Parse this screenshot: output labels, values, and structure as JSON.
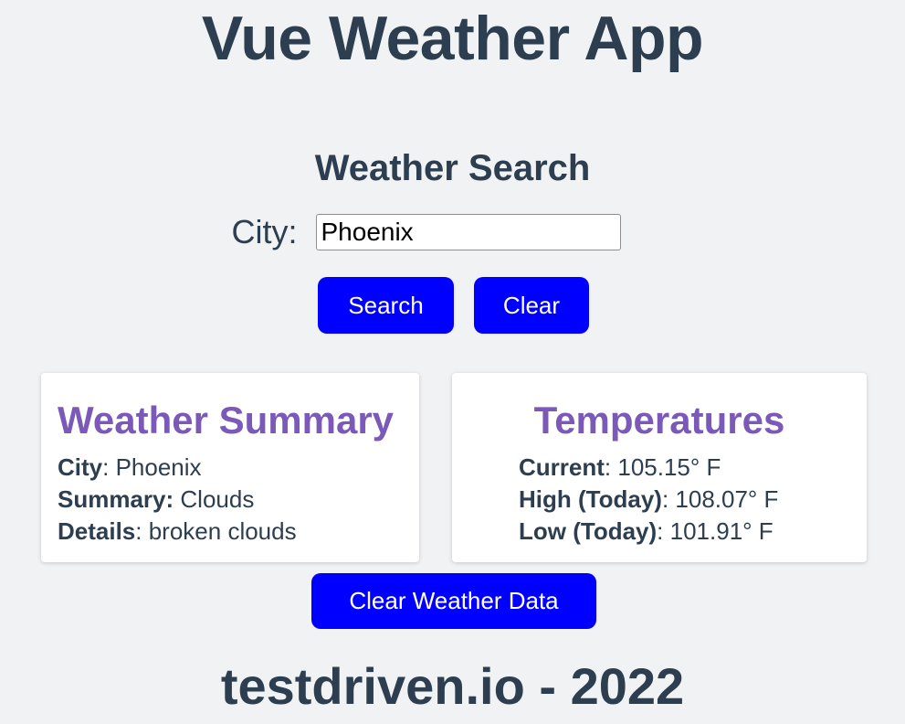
{
  "header": {
    "title": "Vue Weather App"
  },
  "search": {
    "title": "Weather Search",
    "city_label": "City:",
    "city_value": "Phoenix",
    "search_label": "Search",
    "clear_label": "Clear"
  },
  "summary": {
    "title": "Weather Summary",
    "rows": [
      {
        "key": "City",
        "sep": ": ",
        "value": "Phoenix"
      },
      {
        "key": "Summary:",
        "sep": " ",
        "value": "Clouds"
      },
      {
        "key": "Details",
        "sep": ": ",
        "value": "broken clouds"
      }
    ]
  },
  "temperatures": {
    "title": "Temperatures",
    "rows": [
      {
        "key": "Current",
        "sep": ": ",
        "value": "105.15° F"
      },
      {
        "key": "High (Today)",
        "sep": ": ",
        "value": "108.07° F"
      },
      {
        "key": "Low (Today)",
        "sep": ": ",
        "value": "101.91° F"
      }
    ]
  },
  "actions": {
    "clear_weather_label": "Clear Weather Data"
  },
  "footer": {
    "text": "testdriven.io - 2022"
  },
  "colors": {
    "background": "#f1f2f4",
    "text": "#2c3e50",
    "button": "#0000ff",
    "card_title": "#7a59b8"
  }
}
